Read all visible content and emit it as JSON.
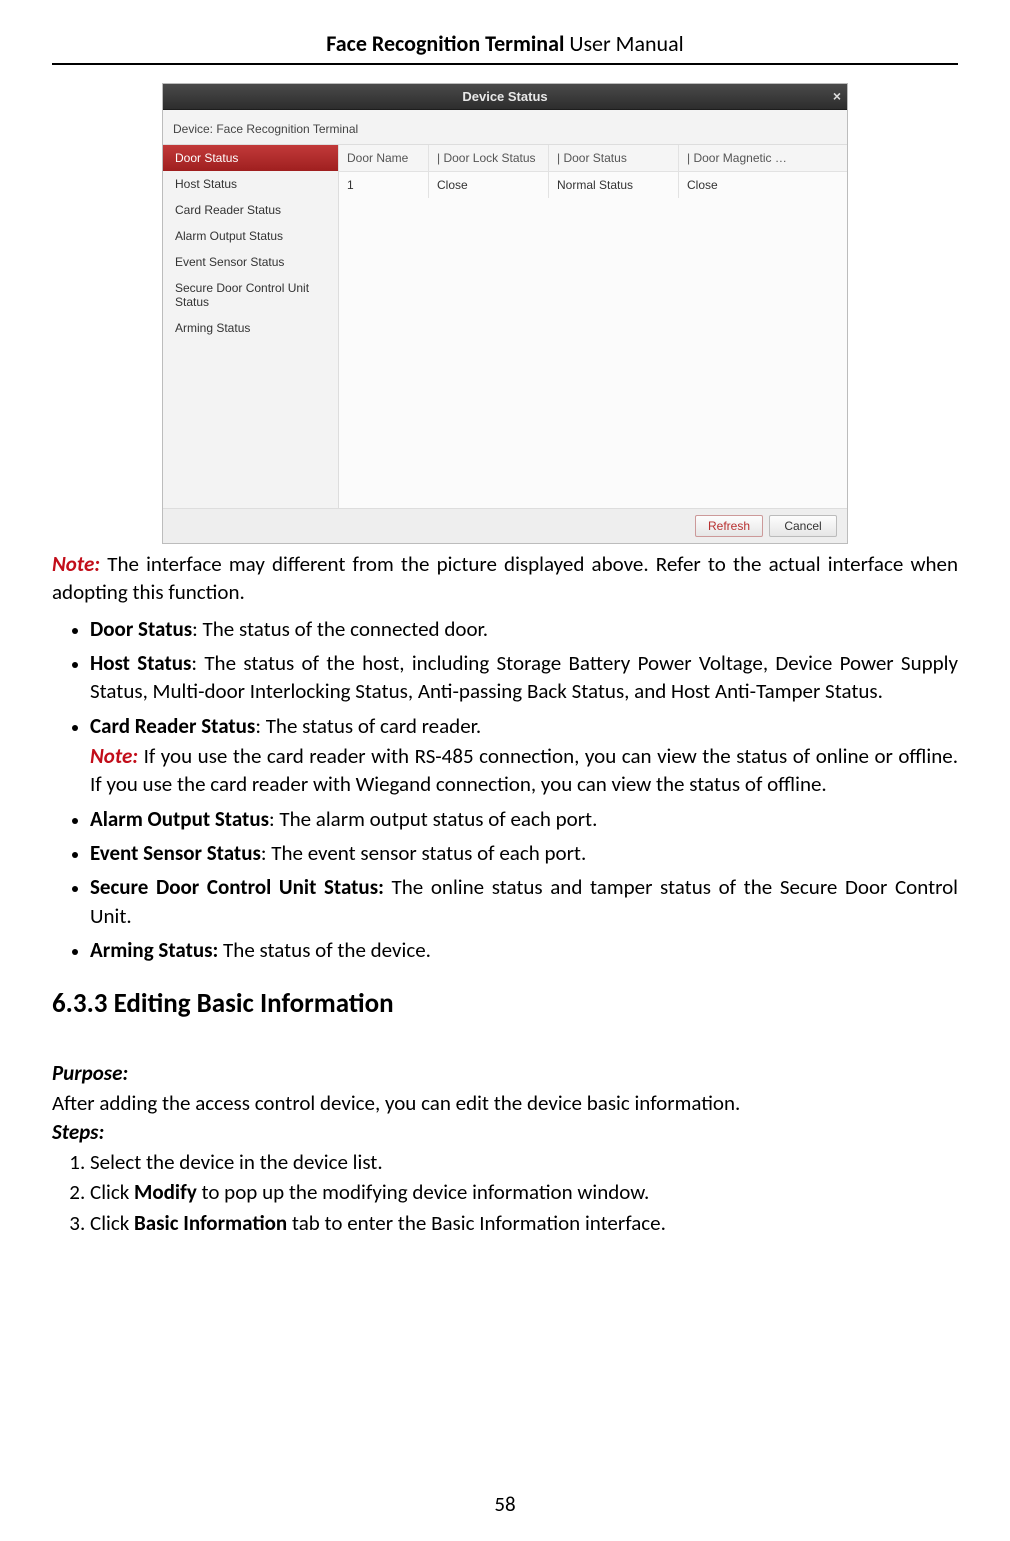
{
  "header": {
    "bold": "Face Recognition Terminal",
    "rest": "  User Manual"
  },
  "dialog": {
    "title": "Device Status",
    "close": "×",
    "device_label": "Device: Face Recognition Terminal",
    "sidebar": [
      "Door Status",
      "Host Status",
      "Card Reader Status",
      "Alarm Output Status",
      "Event Sensor Status",
      "Secure Door Control Unit Status",
      "Arming Status"
    ],
    "columns": [
      "Door Name",
      "| Door Lock Status",
      "| Door Status",
      "| Door Magnetic …"
    ],
    "row": [
      "1",
      "Close",
      "Normal Status",
      "Close"
    ],
    "buttons": {
      "refresh": "Refresh",
      "cancel": "Cancel"
    }
  },
  "note_label": "Note:",
  "note_text": " The interface may different from the picture displayed above. Refer to the actual interface when adopting this function.",
  "bullets": [
    {
      "term": "Door Status",
      "sep": ": ",
      "text": "The status of the connected door."
    },
    {
      "term": "Host Status",
      "sep": ": ",
      "text": "The status of the host, including Storage Battery Power Voltage, Device Power Supply Status, Multi-door Interlocking Status, Anti-passing Back Status, and Host Anti-Tamper Status."
    },
    {
      "term": "Card Reader Status",
      "sep": ": ",
      "text": "The status of card reader.",
      "subnote_label": "Note:",
      "subnote_text": " If you use the card reader with RS-485 connection, you can view the status of online or offline. If you use the card reader with Wiegand connection, you can view the status of offline."
    },
    {
      "term": "Alarm Output Status",
      "sep": ": ",
      "text": "The alarm output status of each port."
    },
    {
      "term": "Event Sensor Status",
      "sep": ": ",
      "text": "The event sensor status of each port."
    },
    {
      "term": "Secure Door Control Unit Status:",
      "sep": " ",
      "text": "The online status and tamper status of the Secure Door Control Unit."
    },
    {
      "term": "Arming Status:",
      "sep": " ",
      "text": "The status of the device."
    }
  ],
  "heading_633": "6.3.3   Editing Basic Information",
  "purpose_label": "Purpose:",
  "purpose_text": "After adding the access control device, you can edit the device basic information.",
  "steps_label": "Steps:",
  "steps": [
    {
      "pre": "Select the device in the device list."
    },
    {
      "pre": "Click ",
      "bold": "Modify",
      "post": " to pop up the modifying device information window."
    },
    {
      "pre": "Click ",
      "bold": "Basic Information",
      "post": " tab to enter the Basic Information interface."
    }
  ],
  "page_number": "58"
}
